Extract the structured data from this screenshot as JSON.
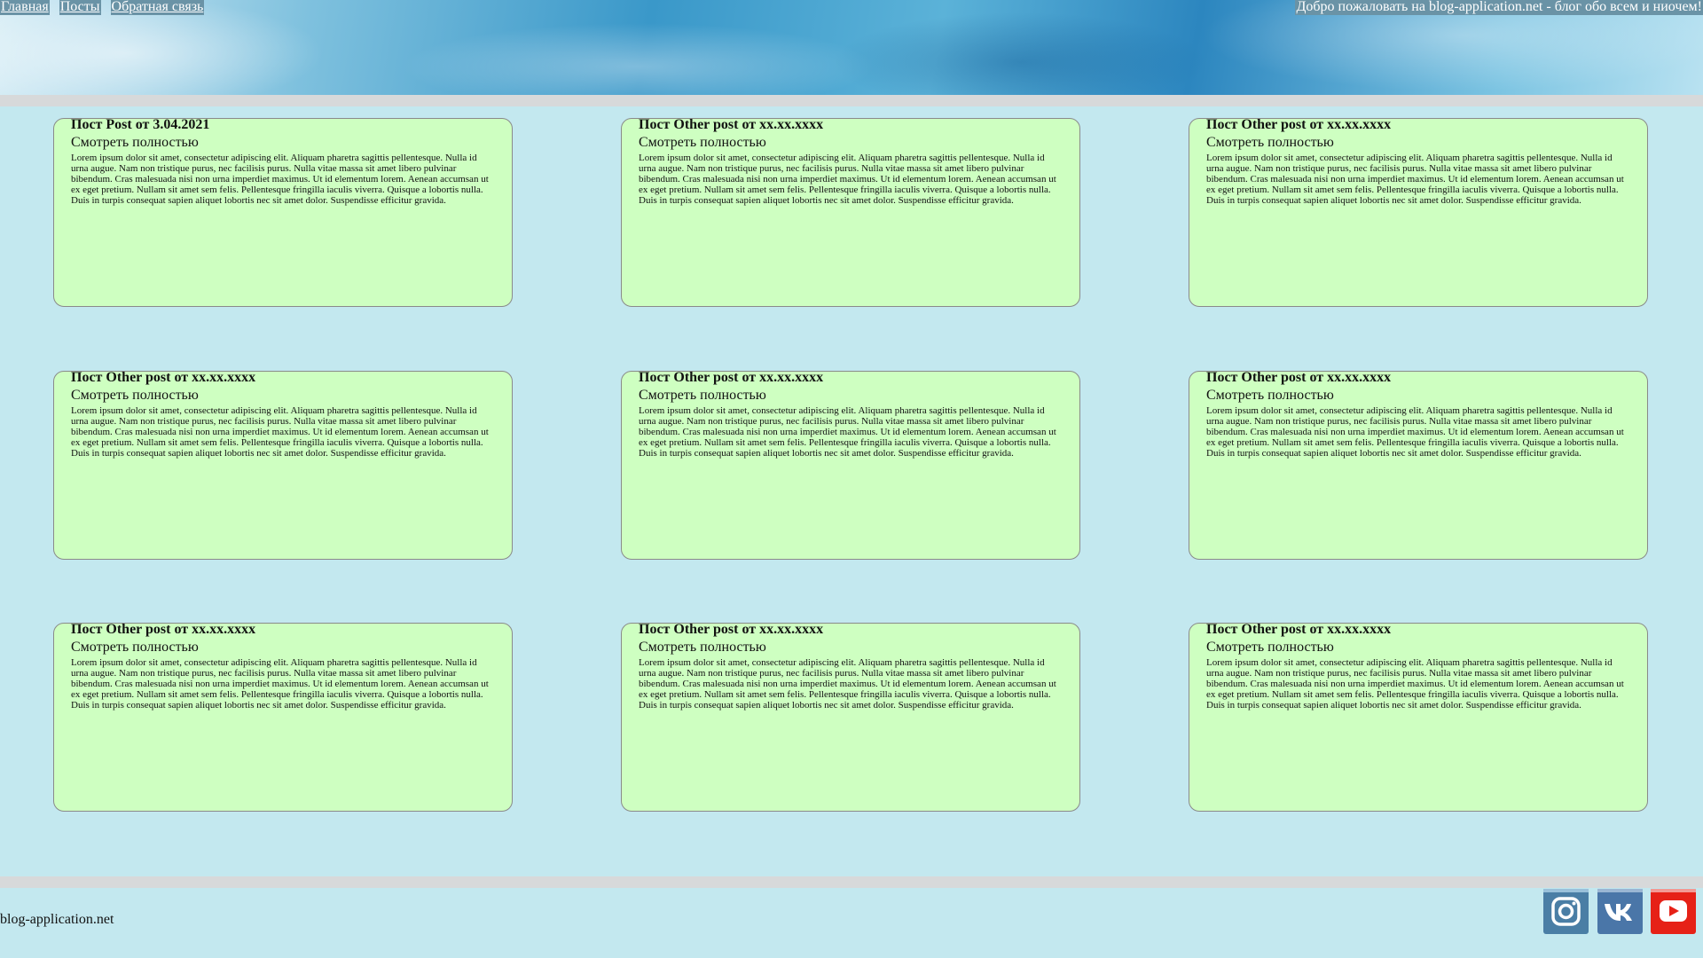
{
  "nav": {
    "items": [
      "Главная",
      "Посты",
      "Обратная связь"
    ],
    "welcome": "Добро пожаловать на blog-application.net - блог обо всем и ниочем!"
  },
  "posts": [
    {
      "title": "Пост Post от 3.04.2021",
      "more": "Смотреть полностью",
      "body": "Lorem ipsum dolor sit amet, consectetur adipiscing elit. Aliquam pharetra sagittis pellentesque. Nulla id urna augue. Nam non tristique purus, nec facilisis purus. Nulla vitae massa sit amet libero pulvinar bibendum. Cras malesuada nisi non urna imperdiet maximus. Ut id elementum lorem. Aenean accumsan ut ex eget pretium. Nullam sit amet sem felis. Pellentesque fringilla iaculis viverra. Quisque a lobortis nulla. Duis in turpis consequat sapien aliquet lobortis nec sit amet dolor. Suspendisse efficitur gravida."
    },
    {
      "title": "Пост Other post от xx.xx.xxxx",
      "more": "Смотреть полностью",
      "body": "Lorem ipsum dolor sit amet, consectetur adipiscing elit. Aliquam pharetra sagittis pellentesque. Nulla id urna augue. Nam non tristique purus, nec facilisis purus. Nulla vitae massa sit amet libero pulvinar bibendum. Cras malesuada nisi non urna imperdiet maximus. Ut id elementum lorem. Aenean accumsan ut ex eget pretium. Nullam sit amet sem felis. Pellentesque fringilla iaculis viverra. Quisque a lobortis nulla. Duis in turpis consequat sapien aliquet lobortis nec sit amet dolor. Suspendisse efficitur gravida."
    },
    {
      "title": "Пост Other post от xx.xx.xxxx",
      "more": "Смотреть полностью",
      "body": "Lorem ipsum dolor sit amet, consectetur adipiscing elit. Aliquam pharetra sagittis pellentesque. Nulla id urna augue. Nam non tristique purus, nec facilisis purus. Nulla vitae massa sit amet libero pulvinar bibendum. Cras malesuada nisi non urna imperdiet maximus. Ut id elementum lorem. Aenean accumsan ut ex eget pretium. Nullam sit amet sem felis. Pellentesque fringilla iaculis viverra. Quisque a lobortis nulla. Duis in turpis consequat sapien aliquet lobortis nec sit amet dolor. Suspendisse efficitur gravida."
    },
    {
      "title": "Пост Other post от xx.xx.xxxx",
      "more": "Смотреть полностью",
      "body": "Lorem ipsum dolor sit amet, consectetur adipiscing elit. Aliquam pharetra sagittis pellentesque. Nulla id urna augue. Nam non tristique purus, nec facilisis purus. Nulla vitae massa sit amet libero pulvinar bibendum. Cras malesuada nisi non urna imperdiet maximus. Ut id elementum lorem. Aenean accumsan ut ex eget pretium. Nullam sit amet sem felis. Pellentesque fringilla iaculis viverra. Quisque a lobortis nulla. Duis in turpis consequat sapien aliquet lobortis nec sit amet dolor. Suspendisse efficitur gravida."
    },
    {
      "title": "Пост Other post от xx.xx.xxxx",
      "more": "Смотреть полностью",
      "body": "Lorem ipsum dolor sit amet, consectetur adipiscing elit. Aliquam pharetra sagittis pellentesque. Nulla id urna augue. Nam non tristique purus, nec facilisis purus. Nulla vitae massa sit amet libero pulvinar bibendum. Cras malesuada nisi non urna imperdiet maximus. Ut id elementum lorem. Aenean accumsan ut ex eget pretium. Nullam sit amet sem felis. Pellentesque fringilla iaculis viverra. Quisque a lobortis nulla. Duis in turpis consequat sapien aliquet lobortis nec sit amet dolor. Suspendisse efficitur gravida."
    },
    {
      "title": "Пост Other post от xx.xx.xxxx",
      "more": "Смотреть полностью",
      "body": "Lorem ipsum dolor sit amet, consectetur adipiscing elit. Aliquam pharetra sagittis pellentesque. Nulla id urna augue. Nam non tristique purus, nec facilisis purus. Nulla vitae massa sit amet libero pulvinar bibendum. Cras malesuada nisi non urna imperdiet maximus. Ut id elementum lorem. Aenean accumsan ut ex eget pretium. Nullam sit amet sem felis. Pellentesque fringilla iaculis viverra. Quisque a lobortis nulla. Duis in turpis consequat sapien aliquet lobortis nec sit amet dolor. Suspendisse efficitur gravida."
    },
    {
      "title": "Пост Other post от xx.xx.xxxx",
      "more": "Смотреть полностью",
      "body": "Lorem ipsum dolor sit amet, consectetur adipiscing elit. Aliquam pharetra sagittis pellentesque. Nulla id urna augue. Nam non tristique purus, nec facilisis purus. Nulla vitae massa sit amet libero pulvinar bibendum. Cras malesuada nisi non urna imperdiet maximus. Ut id elementum lorem. Aenean accumsan ut ex eget pretium. Nullam sit amet sem felis. Pellentesque fringilla iaculis viverra. Quisque a lobortis nulla. Duis in turpis consequat sapien aliquet lobortis nec sit amet dolor. Suspendisse efficitur gravida."
    },
    {
      "title": "Пост Other post от xx.xx.xxxx",
      "more": "Смотреть полностью",
      "body": "Lorem ipsum dolor sit amet, consectetur adipiscing elit. Aliquam pharetra sagittis pellentesque. Nulla id urna augue. Nam non tristique purus, nec facilisis purus. Nulla vitae massa sit amet libero pulvinar bibendum. Cras malesuada nisi non urna imperdiet maximus. Ut id elementum lorem. Aenean accumsan ut ex eget pretium. Nullam sit amet sem felis. Pellentesque fringilla iaculis viverra. Quisque a lobortis nulla. Duis in turpis consequat sapien aliquet lobortis nec sit amet dolor. Suspendisse efficitur gravida."
    },
    {
      "title": "Пост Other post от xx.xx.xxxx",
      "more": "Смотреть полностью",
      "body": "Lorem ipsum dolor sit amet, consectetur adipiscing elit. Aliquam pharetra sagittis pellentesque. Nulla id urna augue. Nam non tristique purus, nec facilisis purus. Nulla vitae massa sit amet libero pulvinar bibendum. Cras malesuada nisi non urna imperdiet maximus. Ut id elementum lorem. Aenean accumsan ut ex eget pretium. Nullam sit amet sem felis. Pellentesque fringilla iaculis viverra. Quisque a lobortis nulla. Duis in turpis consequat sapien aliquet lobortis nec sit amet dolor. Suspendisse efficitur gravida."
    }
  ],
  "footer": {
    "site": "blog-application.net",
    "social": [
      {
        "icon": "instagram-icon",
        "color": "#4a7ea5"
      },
      {
        "icon": "vk-icon",
        "color": "#4a76a8"
      },
      {
        "icon": "youtube-icon",
        "color": "#e62117"
      }
    ]
  },
  "colors": {
    "background": "#c3e8ef",
    "card": "#ceffc1",
    "nav_link_bg": "#6a93a6",
    "band": "#d7d9da"
  }
}
